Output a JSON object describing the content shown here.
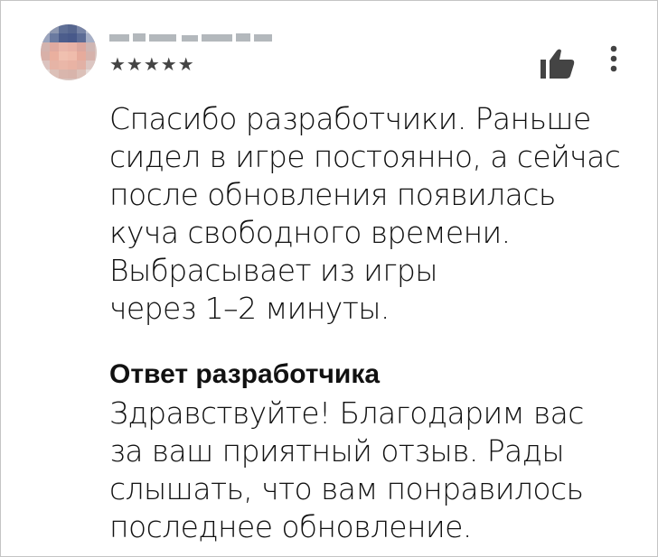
{
  "review": {
    "author": {
      "avatar": "avatar-pixelated",
      "name_blurred": true
    },
    "rating": {
      "stars": 5,
      "max": 5,
      "display": "★★★★★"
    },
    "text": "Спасибо разработчики. Раньше\nсидел в игре постоянно, а сейчас\nпосле обновления появилась\nкуча свободного времени.\nВыбрасывает из игры\nчерез 1–2 минуты.",
    "actions": {
      "like_icon": "thumbs-up-icon",
      "menu_icon": "more-vert-icon"
    }
  },
  "developer_reply": {
    "title": "Ответ разработчика",
    "text": "Здравствуйте! Благодарим вас\nза ваш приятный отзыв. Рады\nслышать, что вам понравилось\nпоследнее обновление."
  },
  "colors": {
    "text": "#111111",
    "border": "#c4c4c4",
    "icon": "#444444",
    "background": "#ffffff"
  }
}
